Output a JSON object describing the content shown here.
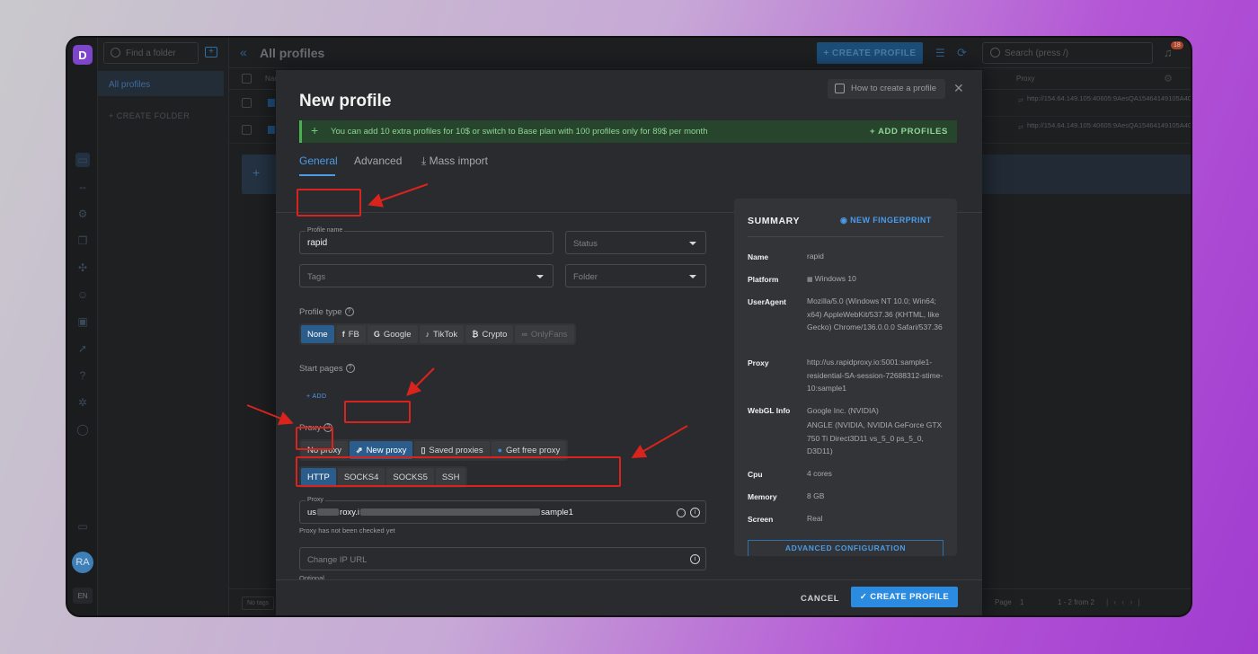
{
  "app": {
    "logo_letter": "D",
    "folder_search_placeholder": "Find a folder",
    "folders": [
      "All profiles"
    ],
    "create_folder_label": "+ CREATE FOLDER",
    "page_title": "All profiles",
    "create_profile_top": "+ CREATE PROFILE",
    "search_placeholder": "Search (press /)",
    "notification_count": "18",
    "avatar_initials": "RA",
    "language": "EN",
    "table": {
      "col_name": "Name",
      "col_proxy": "Proxy",
      "rows": [
        {
          "proxy": "http://154.64.149.105:40605:9AesQA15464149105A40605:l915ssxwpolol"
        },
        {
          "proxy": "http://154.64.149.105:40605:9AesQA15464149105A40605:l915ssxwpolol"
        }
      ],
      "add_row_label": "+"
    },
    "footer": {
      "tags_label": "No tags",
      "page_label": "Page",
      "page_number": "1",
      "count_label": "1 - 2 from 2"
    }
  },
  "modal": {
    "title": "New profile",
    "how_to_label": "How to create a profile",
    "banner_text": "You can add 10 extra profiles for 10$ or switch to Base plan with 100 profiles only for 89$ per month",
    "banner_action": "+ ADD PROFILES",
    "tabs": [
      "General",
      "Advanced",
      "Mass import"
    ],
    "profile_name_label": "Profile name",
    "profile_name_value": "rapid",
    "status_placeholder": "Status",
    "tags_placeholder": "Tags",
    "folder_placeholder": "Folder",
    "profile_type_label": "Profile type",
    "profile_types": [
      {
        "label": "None",
        "icon": "",
        "selected": true
      },
      {
        "label": "FB",
        "icon": "f"
      },
      {
        "label": "Google",
        "icon": "G"
      },
      {
        "label": "TikTok",
        "icon": "♪"
      },
      {
        "label": "Crypto",
        "icon": "₿"
      },
      {
        "label": "OnlyFans",
        "icon": "∞",
        "disabled": true
      }
    ],
    "start_pages_label": "Start pages",
    "add_label": "+ ADD",
    "proxy_label": "Proxy",
    "proxy_modes": [
      {
        "label": "No proxy"
      },
      {
        "label": "New proxy",
        "icon": "⇗",
        "selected": true
      },
      {
        "label": "Saved proxies",
        "icon": "▯"
      },
      {
        "label": "Get free proxy",
        "icon": "●"
      }
    ],
    "proxy_types": [
      {
        "label": "HTTP",
        "selected": true
      },
      {
        "label": "SOCKS4"
      },
      {
        "label": "SOCKS5"
      },
      {
        "label": "SSH"
      }
    ],
    "proxy_field_label": "Proxy",
    "proxy_value_start": "us",
    "proxy_value_mid": "roxy.i",
    "proxy_value_end": "sample1",
    "proxy_status": "Proxy has not been checked yet",
    "change_ip_placeholder": "Change IP URL",
    "optional_label": "Optional",
    "cancel_label": "CANCEL",
    "create_label": "✓ CREATE PROFILE"
  },
  "summary": {
    "title": "SUMMARY",
    "new_fingerprint": "NEW FINGERPRINT",
    "items": [
      {
        "key": "Name",
        "value": "rapid"
      },
      {
        "key": "Platform",
        "value": "Windows 10"
      },
      {
        "key": "UserAgent",
        "value": "Mozilla/5.0 (Windows NT 10.0; Win64; x64) AppleWebKit/537.36 (KHTML, like Gecko) Chrome/136.0.0.0 Safari/537.36"
      },
      {
        "key": "Proxy",
        "value": "http://us.rapidproxy.io:5001:sample1-residential-SA-session-72688312-stime-10:sample1"
      },
      {
        "key": "WebGL Info",
        "value": "Google Inc. (NVIDIA)"
      },
      {
        "key": "",
        "value": "ANGLE (NVIDIA, NVIDIA GeForce GTX 750 Ti Direct3D11 vs_5_0 ps_5_0, D3D11)"
      },
      {
        "key": "Cpu",
        "value": "4 cores"
      },
      {
        "key": "Memory",
        "value": "8 GB"
      },
      {
        "key": "Screen",
        "value": "Real"
      }
    ],
    "advanced_config": "ADVANCED CONFIGURATION"
  },
  "colors": {
    "accent": "#2b8be0",
    "annotation_red": "#d9241d",
    "banner_green": "#4caf50"
  }
}
